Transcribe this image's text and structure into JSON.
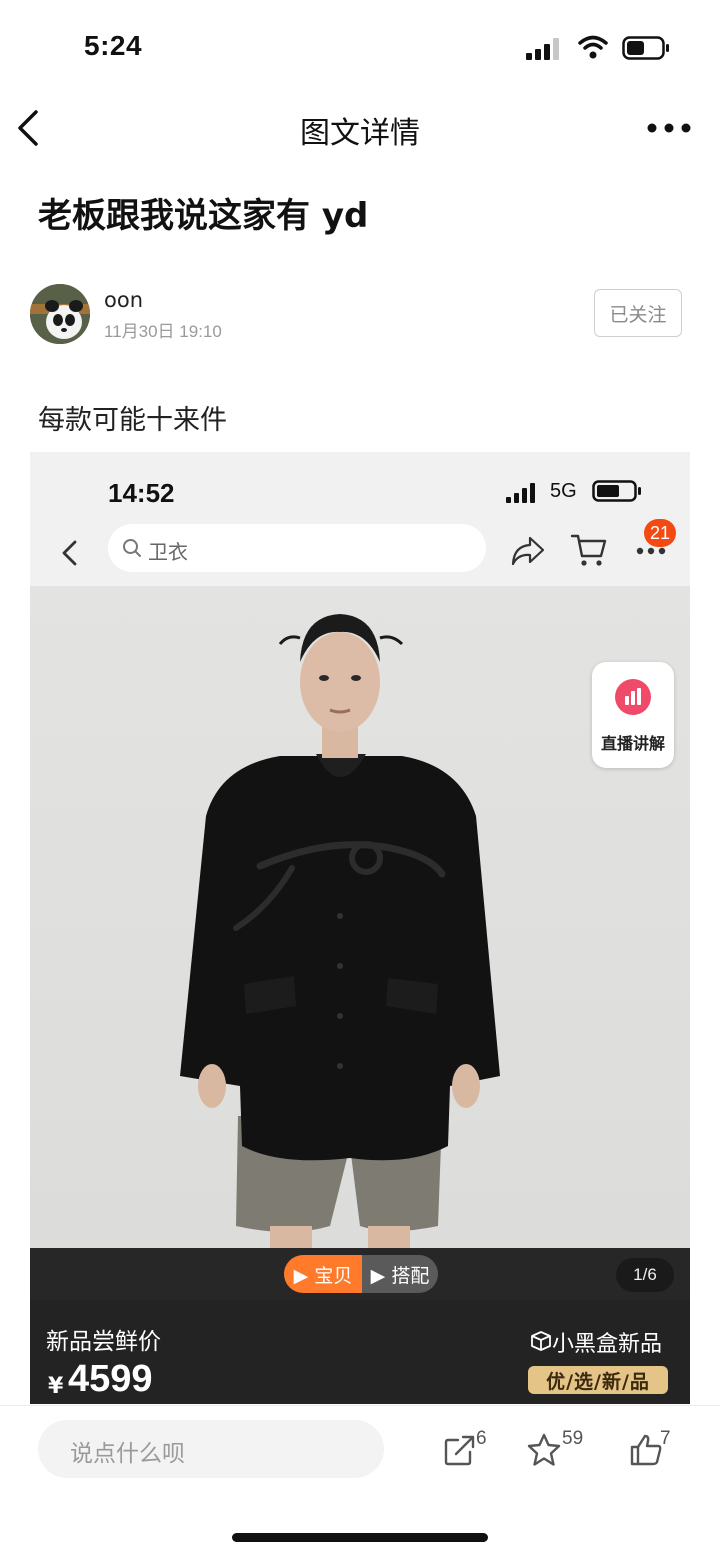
{
  "status_bar": {
    "time": "5:24"
  },
  "nav": {
    "title": "图文详情"
  },
  "post": {
    "title": "老板跟我说这家有 yd",
    "author": {
      "name": "oon",
      "date": "11月30日 19:10",
      "follow_label": "已关注"
    },
    "body": "每款可能十来件"
  },
  "embedded_screenshot": {
    "time": "14:52",
    "network": "5G",
    "search_placeholder": "卫衣",
    "more_badge": "21",
    "live_label": "直播讲解",
    "tabs": [
      {
        "label": "▶ 宝贝",
        "active": true
      },
      {
        "label": "▶ 搭配",
        "active": false
      }
    ],
    "image_counter": "1/6",
    "price_label": "新品尝鲜价",
    "currency": "¥",
    "price": "4599",
    "brand_name": "小黑盒新品",
    "brand_tag": "优/选/新/品",
    "accent_color": "#ff7a2a"
  },
  "footer": {
    "comment_placeholder": "说点什么呗",
    "share_count": "6",
    "favorite_count": "59",
    "like_count": "7"
  }
}
